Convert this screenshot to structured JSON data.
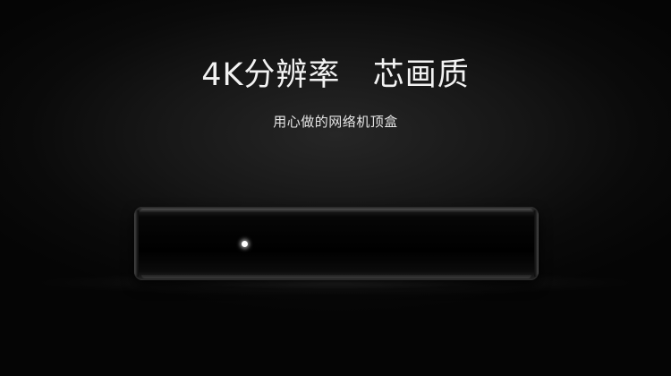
{
  "hero": {
    "headline": "4K分辨率   芯画质",
    "tagline": "用心做的网络机顶盒"
  },
  "colors": {
    "background": "#050505",
    "text": "#f2f2f2",
    "device": "#000000",
    "led": "#ffffff"
  }
}
